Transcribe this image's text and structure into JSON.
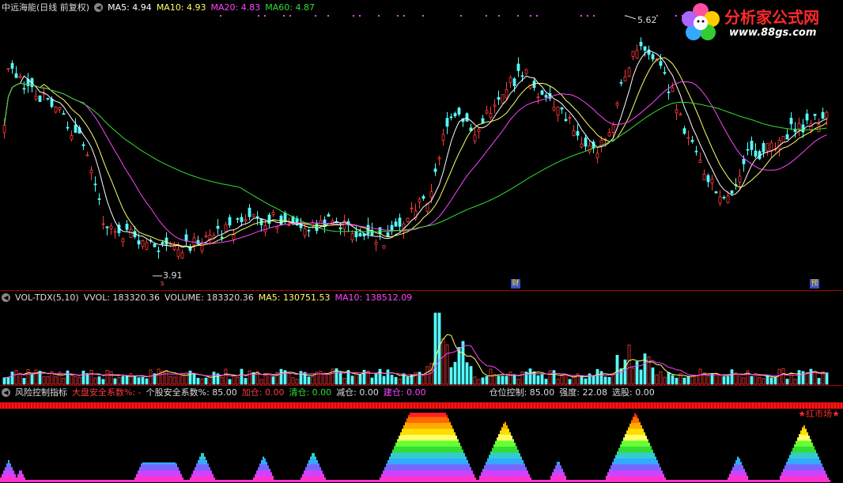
{
  "price_panel": {
    "stock_name": "中远海能(日线 前复权)",
    "ma5_label": "MA5: 4.94",
    "ma10_label": "MA10: 4.93",
    "ma20_label": "MA20: 4.83",
    "ma60_label": "MA60: 4.87",
    "high_marker": "5.62",
    "low_marker": "3.91",
    "badge_cai": "财",
    "badge_yu": "预",
    "small_s": "s"
  },
  "volume_panel": {
    "indicator": "VOL-TDX(5,10)",
    "vvol": "VVOL: 183320.36",
    "volume": "VOLUME: 183320.36",
    "ma5": "MA5: 130751.53",
    "ma10": "MA10: 138512.09"
  },
  "risk_panel": {
    "title": "风险控制指标",
    "market_safety": "大盘安全系数%: -",
    "stock_safety": "个股安全系数%: 85.00",
    "add": "加仓: 0.00",
    "clear": "清仓: 0.00",
    "reduce": "减仓: 0.00",
    "build": "建仓: 0.00",
    "position": "仓位控制: 85.00",
    "strength": "强度: 22.08",
    "select": "选股: 0.00",
    "red_market": "★红市场★"
  },
  "logo": {
    "text": "分析家公式网",
    "url": "www.88gs.com"
  },
  "colors": {
    "up": "#ff3a3a",
    "down": "#54ffff",
    "ma5": "#ffffff",
    "ma10": "#ffff66",
    "ma20": "#ff44ff",
    "ma60": "#33dd33",
    "border": "#b00000"
  }
}
